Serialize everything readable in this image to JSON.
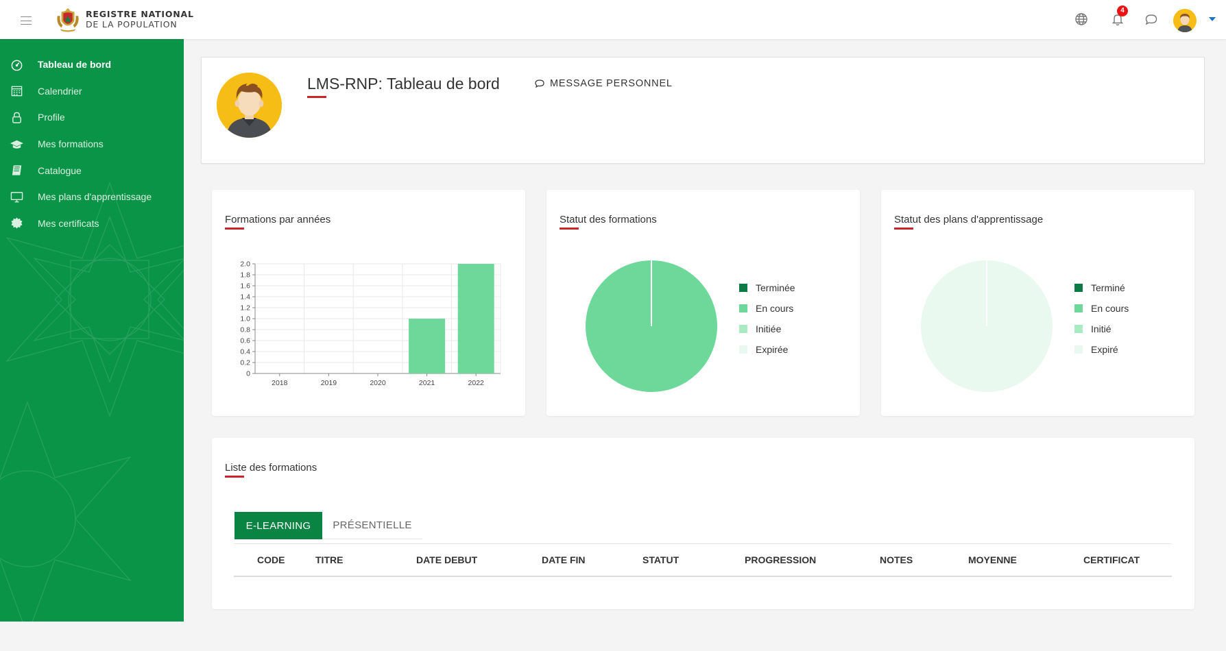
{
  "brand": {
    "line1": "REGISTRE NATIONAL",
    "line2": "DE LA POPULATION"
  },
  "notifications": {
    "count": "4"
  },
  "sidebar": {
    "items": [
      {
        "label": "Tableau de bord",
        "icon": "dashboard-icon",
        "active": true
      },
      {
        "label": "Calendrier",
        "icon": "calendar-icon"
      },
      {
        "label": "Profile",
        "icon": "user-icon"
      },
      {
        "label": "Mes formations",
        "icon": "graduation-cap-icon"
      },
      {
        "label": "Catalogue",
        "icon": "book-icon"
      },
      {
        "label": "Mes plans d'apprentissage",
        "icon": "monitor-icon"
      },
      {
        "label": "Mes certificats",
        "icon": "certificate-icon"
      }
    ]
  },
  "header": {
    "title": "LMS-RNP: Tableau de bord",
    "message_label": "MESSAGE PERSONNEL"
  },
  "cards": {
    "formations_par_annees": "Formations par années",
    "statut_formations": "Statut des formations",
    "statut_plans": "Statut des plans d'apprentissage",
    "liste_formations": "Liste des formations"
  },
  "colors": {
    "primary_green": "#0a9448",
    "accent_red": "#c9252c",
    "bar_green": "#6dd89a"
  },
  "chart_data": [
    {
      "type": "bar",
      "title": "Formations par années",
      "categories": [
        "2018",
        "2019",
        "2020",
        "2021",
        "2022"
      ],
      "values": [
        0,
        0,
        0,
        1,
        2
      ],
      "ylim": [
        0,
        2
      ],
      "yticks": [
        "0",
        "0.2",
        "0.4",
        "0.6",
        "0.8",
        "1.0",
        "1.2",
        "1.4",
        "1.6",
        "1.8",
        "2.0"
      ],
      "grid": true
    },
    {
      "type": "pie",
      "title": "Statut des formations",
      "labels": [
        "Terminée",
        "En cours",
        "Initiée",
        "Expirée"
      ],
      "colors": [
        "#0c7a44",
        "#6dd89a",
        "#a9ebc4",
        "#e9f9ef"
      ],
      "values": [
        0,
        1,
        0,
        0
      ],
      "legend": "right"
    },
    {
      "type": "pie",
      "title": "Statut des plans d'apprentissage",
      "labels": [
        "Terminé",
        "En cours",
        "Initié",
        "Expiré"
      ],
      "colors": [
        "#0c7a44",
        "#6dd89a",
        "#a9ebc4",
        "#e9f9ef"
      ],
      "values": [
        0,
        0,
        0,
        1
      ],
      "legend": "right"
    }
  ],
  "tabs": [
    {
      "label": "E-LEARNING",
      "active": true
    },
    {
      "label": "PRÉSENTIELLE",
      "active": false
    }
  ],
  "table": {
    "columns": [
      "CODE",
      "TITRE",
      "DATE DEBUT",
      "DATE FIN",
      "STATUT",
      "PROGRESSION",
      "NOTES",
      "MOYENNE",
      "CERTIFICAT"
    ]
  }
}
